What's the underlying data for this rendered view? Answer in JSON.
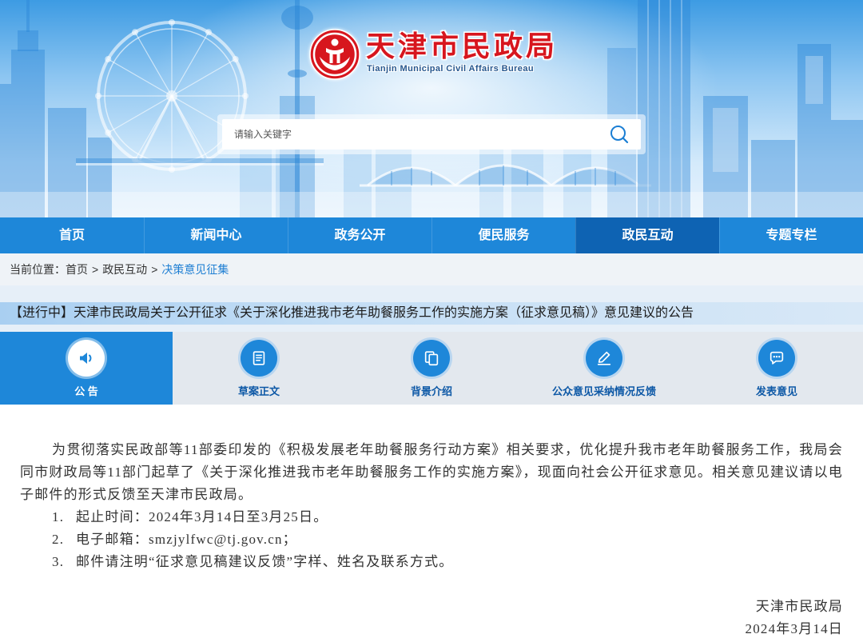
{
  "colors": {
    "primary": "#1e87d9",
    "nav_active": "#0e63b3",
    "brand_red": "#d7161e",
    "link": "#1f7fd3",
    "tab_label": "#0d58a6"
  },
  "header": {
    "logo_icon": "civil-affairs-emblem-icon",
    "title": "天津市民政局",
    "subtitle": "Tianjin Municipal Civil Affairs Bureau"
  },
  "search": {
    "placeholder": "请输入关键字",
    "value": "",
    "icon": "search-icon"
  },
  "nav": {
    "items": [
      {
        "label": "首页",
        "active": false
      },
      {
        "label": "新闻中心",
        "active": false
      },
      {
        "label": "政务公开",
        "active": false
      },
      {
        "label": "便民服务",
        "active": false
      },
      {
        "label": "政民互动",
        "active": true
      },
      {
        "label": "专题专栏",
        "active": false
      }
    ]
  },
  "breadcrumb": {
    "prefix": "当前位置：",
    "separator": ">",
    "items": [
      "首页",
      "政民互动",
      "决策意见征集"
    ]
  },
  "notice": {
    "status": "【进行中】",
    "title": "天津市民政局关于公开征求《关于深化推进我市老年助餐服务工作的实施方案（征求意见稿）》意见建议的公告"
  },
  "tabs": [
    {
      "label": "公 告",
      "icon": "speaker-icon",
      "active": true
    },
    {
      "label": "草案正文",
      "icon": "document-icon",
      "active": false
    },
    {
      "label": "背景介绍",
      "icon": "copy-icon",
      "active": false
    },
    {
      "label": "公众意见采纳情况反馈",
      "icon": "pen-icon",
      "active": false
    },
    {
      "label": "发表意见",
      "icon": "chat-icon",
      "active": false
    }
  ],
  "content": {
    "paragraph": "为贯彻落实民政部等11部委印发的《积极发展老年助餐服务行动方案》相关要求，优化提升我市老年助餐服务工作，我局会同市财政局等11部门起草了《关于深化推进我市老年助餐服务工作的实施方案》，现面向社会公开征求意见。相关意见建议请以电子邮件的形式反馈至天津市民政局。",
    "items": [
      {
        "num": "1.",
        "text": "起止时间：2024年3月14日至3月25日。"
      },
      {
        "num": "2.",
        "text": "电子邮箱：smzjylfwc@tj.gov.cn；"
      },
      {
        "num": "3.",
        "text": "邮件请注明“征求意见稿建议反馈”字样、姓名及联系方式。"
      }
    ],
    "signature": {
      "org": "天津市民政局",
      "date": "2024年3月14日"
    }
  }
}
